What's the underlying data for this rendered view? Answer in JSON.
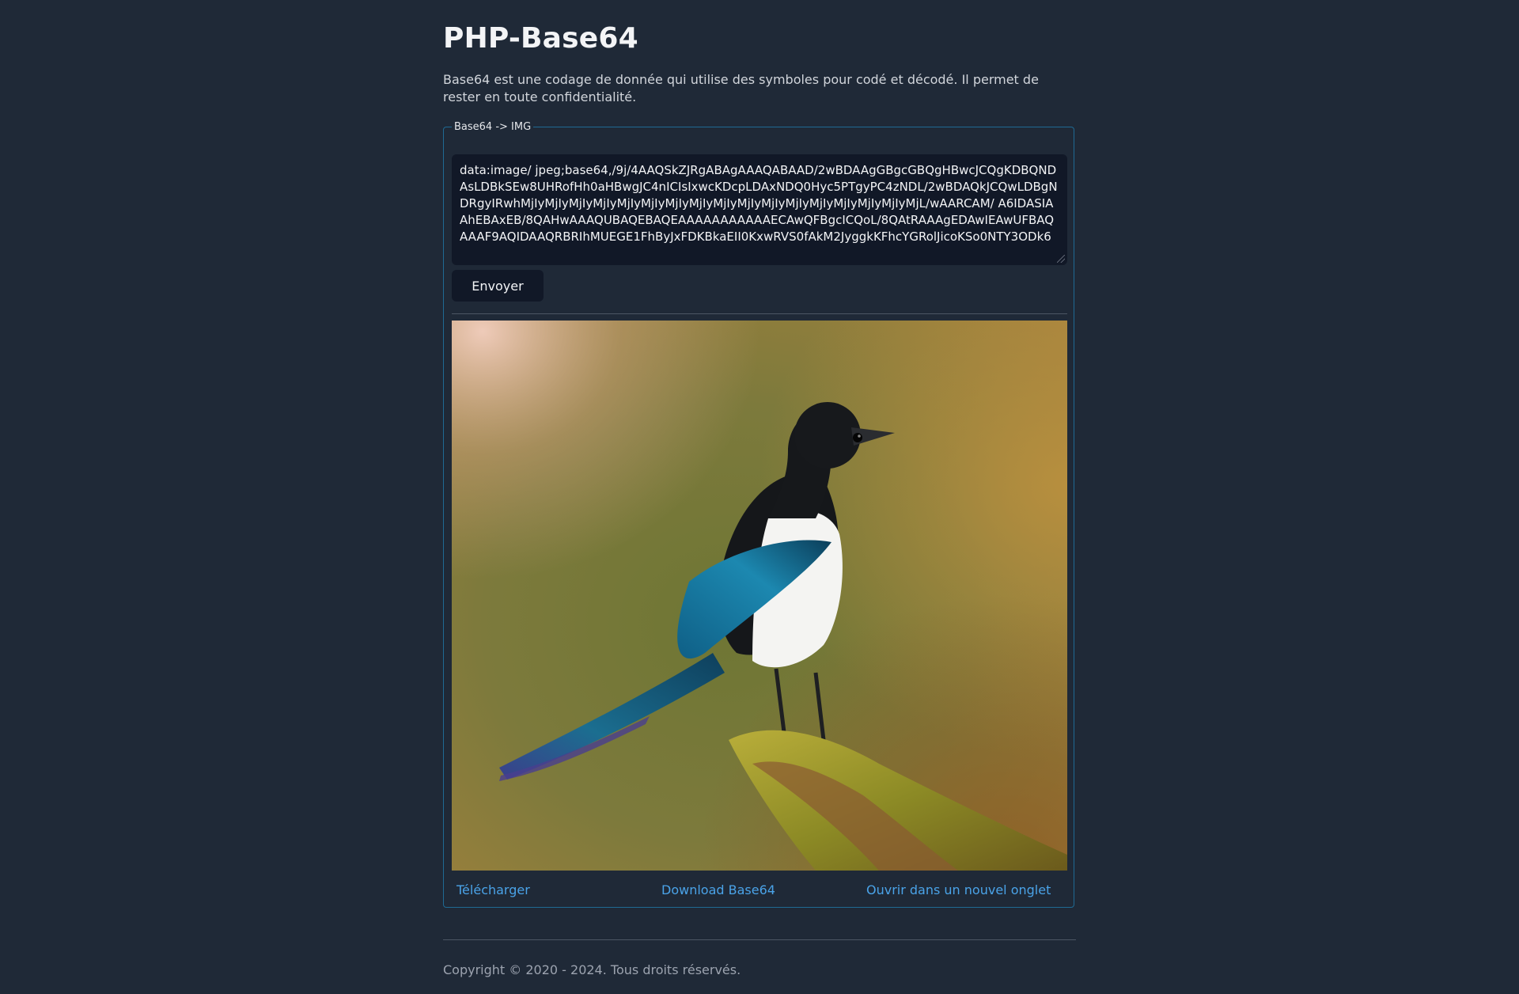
{
  "page": {
    "title": "PHP-Base64",
    "description": "Base64 est une codage de donnée qui utilise des symboles pour codé et décodé. Il permet de rester en toute confidentialité."
  },
  "form": {
    "legend": "Base64 -> IMG",
    "textarea_value": "data:image/ jpeg;base64,/9j/4AAQSkZJRgABAgAAAQABAAD/2wBDAAgGBgcGBQgHBwcJCQgKDBQNDAsLDBkSEw8UHRofHh0aHBwgJC4nICIsIxwcKDcpLDAxNDQ0Hyc5PTgyPC4zNDL/2wBDAQkJCQwLDBgNDRgyIRwhMjIyMjIyMjIyMjIyMjIyMjIyMjIyMjIyMjIyMjIyMjIyMjIyMjIyMjIyMjIyMjIyMjL/wAARCAM/ A6IDASIAAhEBAxEB/8QAHwAAAQUBAQEBAQEAAAAAAAAAAAECAwQFBgcICQoL/8QAtRAAAgEDAwIEAwUFBAQAAAF9AQIDAAQRBRIhMUEGE1FhByJxFDKBkaEII0KxwRVS0fAkM2JyggkKFhcYGRolJicoKSo0NTY3ODk6",
    "submit_label": "Envoyer"
  },
  "preview": {
    "image_alt": "Pie bavarde perchée sur une branche moussue"
  },
  "links": {
    "download": "Télécharger",
    "download_base64": "Download Base64",
    "open_new_tab": "Ouvrir dans un nouvel onglet"
  },
  "footer": {
    "copyright": "Copyright © 2020 - 2024. Tous droits réservés."
  },
  "colors": {
    "background": "#1f2937",
    "fieldset_border": "#1f6a93",
    "link": "#4aa3e8",
    "input_bg": "#111827"
  }
}
